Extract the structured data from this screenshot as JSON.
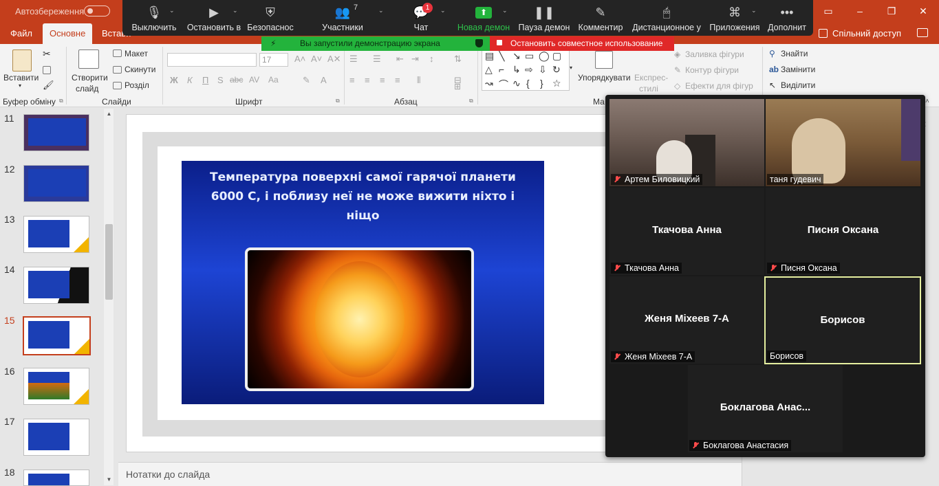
{
  "titlebar": {
    "autosave_label": "Автозбереження",
    "minimize": "–",
    "restore": "❐",
    "close": "✕"
  },
  "tabs": {
    "file": "Файл",
    "home": "Основне",
    "insert": "Встави",
    "share": "Спільний доступ"
  },
  "ribbon": {
    "paste": "Вставити",
    "clipboard_group": "Буфер обміну",
    "new_slide_line1": "Створити",
    "new_slide_line2": "слайд",
    "layout": "Макет",
    "reset": "Скинути",
    "section": "Розділ",
    "slides_group": "Слайди",
    "font_size": "17",
    "font_group": "Шрифт",
    "paragraph_group": "Абзац",
    "arrange": "Упорядкувати",
    "quick_styles_line1": "Експрес-",
    "quick_styles_line2": "стилі",
    "shape_fill": "Заливка фігури",
    "shape_outline": "Контур фігури",
    "shape_effects": "Ефекти для фігур",
    "drawing_group": "Ма",
    "find": "Знайти",
    "replace": "Замінити",
    "select": "Виділити"
  },
  "slide_panel": {
    "thumbnails": [
      {
        "num": "11"
      },
      {
        "num": "12"
      },
      {
        "num": "13"
      },
      {
        "num": "14"
      },
      {
        "num": "15"
      },
      {
        "num": "16"
      },
      {
        "num": "17"
      },
      {
        "num": "18"
      }
    ],
    "active_slide": "15"
  },
  "slide": {
    "title": "Температура поверхні самої гарячої планети 6000 С, і поблизу неї не може вижити ніхто і ніщо"
  },
  "notes": {
    "placeholder": "Нотатки до слайда"
  },
  "zoom": {
    "mute": "Выключить",
    "stop_video": "Остановить в",
    "security": "Безопаснос",
    "participants": "Участники",
    "participants_count": "7",
    "chat": "Чат",
    "chat_badge": "1",
    "new_share": "Новая демон",
    "pause_share": "Пауза демон",
    "annotate": "Комментир",
    "remote_control": "Дистанционное у",
    "apps": "Приложения",
    "more": "Дополнит",
    "notice_sharing": "Вы запустили демонстрацию экрана",
    "stop_share": "Остановить совместное использование"
  },
  "gallery": {
    "tiles": [
      {
        "center": "",
        "tag": "Артем Биловицкий",
        "muted": true
      },
      {
        "center": "",
        "tag": "таня гудевич",
        "muted": false
      },
      {
        "center": "Ткачова Анна",
        "tag": "Ткачова Анна",
        "muted": true
      },
      {
        "center": "Писня Оксана",
        "tag": "Писня Оксана",
        "muted": true
      },
      {
        "center": "Женя Міхеев 7-А",
        "tag": "Женя Міхеев 7-А",
        "muted": true
      },
      {
        "center": "Борисов",
        "tag": "Борисов",
        "muted": false
      },
      {
        "center": "Боклагова  Анас...",
        "tag": "Боклагова Анастасия",
        "muted": true
      }
    ]
  },
  "colors": {
    "accent": "#c43e1c",
    "zoom_green": "#23b33c",
    "zoom_red": "#e02828",
    "slide_yellow": "#f5b700"
  }
}
